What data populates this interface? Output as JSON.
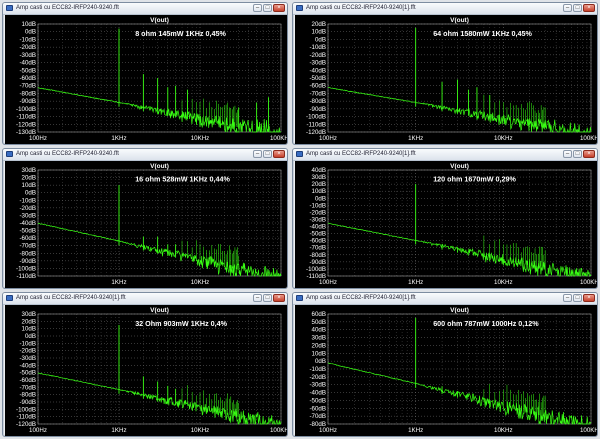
{
  "colors": {
    "trace": "#39ff14",
    "plot_bg": "#000000",
    "grid": "#6e6e6e",
    "label": "#ffffff"
  },
  "windows": [
    {
      "title": "Amp casti cu ECC82-IRFP240-9240.fft",
      "chart_data": {
        "type": "line",
        "trace_name": "V(out)",
        "annotation": "8 ohm  145mW 1KHz 0,45%",
        "yticks": [
          "10dB",
          "0dB",
          "-10dB",
          "-20dB",
          "-30dB",
          "-40dB",
          "-50dB",
          "-60dB",
          "-70dB",
          "-80dB",
          "-90dB",
          "-100dB",
          "-110dB",
          "-120dB",
          "-130dB"
        ],
        "ylim": [
          -130,
          10
        ],
        "xticks": [
          "100Hz",
          "1KHz",
          "10KHz",
          "100KHz"
        ],
        "xlim": [
          100,
          100000
        ],
        "x_scale": "log",
        "grid": true,
        "series": [
          {
            "x": [
              100,
              1000,
              2000,
              3000,
              4000,
              5000,
              7000,
              30000,
              50000,
              70000,
              100000
            ],
            "y": [
              -72,
              4,
              -55,
              -60,
              -72,
              -70,
              -75,
              -98,
              -92,
              -85,
              -130
            ]
          }
        ]
      }
    },
    {
      "title": "Amp casti cu ECC82-IRFP240-9240[1].fft",
      "chart_data": {
        "type": "line",
        "trace_name": "V(out)",
        "annotation": "64 ohm 1580mW 1KHz 0,45%",
        "yticks": [
          "20dB",
          "10dB",
          "0dB",
          "-10dB",
          "-20dB",
          "-30dB",
          "-40dB",
          "-50dB",
          "-60dB",
          "-70dB",
          "-80dB",
          "-90dB",
          "-100dB",
          "-110dB",
          "-120dB"
        ],
        "ylim": [
          -120,
          20
        ],
        "xticks": [
          "100Hz",
          "1KHz",
          "10KHz",
          "100KHz"
        ],
        "xlim": [
          100,
          100000
        ],
        "x_scale": "log",
        "grid": true,
        "series": [
          {
            "x": [
              100,
              1000,
              2000,
              3000,
              4000,
              5000,
              7000,
              100000
            ],
            "y": [
              -62,
              15,
              -55,
              -52,
              -65,
              -62,
              -72,
              -120
            ]
          }
        ]
      }
    },
    {
      "title": "Amp casti cu ECC82-IRFP240-9240.fft",
      "chart_data": {
        "type": "line",
        "trace_name": "V(out)",
        "annotation": "16 ohm 528mW 1KHz 0,44%",
        "yticks": [
          "30dB",
          "20dB",
          "10dB",
          "0dB",
          "-10dB",
          "-20dB",
          "-30dB",
          "-40dB",
          "-50dB",
          "-60dB",
          "-70dB",
          "-80dB",
          "-90dB",
          "-100dB",
          "-110dB"
        ],
        "ylim": [
          -110,
          30
        ],
        "xticks": [
          "1KHz",
          "10KHz"
        ],
        "xlim": [
          100,
          100000
        ],
        "x_scale": "log",
        "grid": true,
        "series": [
          {
            "x": [
              100,
              1000,
              2000,
              3000,
              4000,
              5000,
              100000
            ],
            "y": [
              -40,
              10,
              -58,
              -58,
              -68,
              -68,
              -110
            ]
          }
        ]
      }
    },
    {
      "title": "Amp casti cu ECC82-IRFP240-9240[1].fft",
      "chart_data": {
        "type": "line",
        "trace_name": "V(out)",
        "annotation": "120 ohm 1670mW 0,29%",
        "yticks": [
          "40dB",
          "30dB",
          "20dB",
          "10dB",
          "0dB",
          "-10dB",
          "-20dB",
          "-30dB",
          "-40dB",
          "-50dB",
          "-60dB",
          "-70dB",
          "-80dB",
          "-90dB",
          "-100dB",
          "-110dB"
        ],
        "ylim": [
          -110,
          40
        ],
        "xticks": [
          "100Hz",
          "1KHz",
          "10KHz",
          "100KHz"
        ],
        "xlim": [
          100,
          100000
        ],
        "x_scale": "log",
        "grid": true,
        "series": [
          {
            "x": [
              100,
              1000,
              2000,
              3000,
              100000
            ],
            "y": [
              -35,
              20,
              -65,
              -70,
              -108
            ]
          }
        ]
      }
    },
    {
      "title": "Amp casti cu ECC82-IRFP240-9240[1].fft",
      "chart_data": {
        "type": "line",
        "trace_name": "V(out)",
        "annotation": "32 Ohm 903mW 1KHz 0,4%",
        "yticks": [
          "30dB",
          "20dB",
          "10dB",
          "0dB",
          "-10dB",
          "-20dB",
          "-30dB",
          "-40dB",
          "-50dB",
          "-60dB",
          "-70dB",
          "-80dB",
          "-90dB",
          "-100dB",
          "-110dB",
          "-120dB"
        ],
        "ylim": [
          -120,
          30
        ],
        "xticks": [
          "100Hz",
          "1KHz",
          "10KHz",
          "100KHz"
        ],
        "xlim": [
          100,
          100000
        ],
        "x_scale": "log",
        "grid": true,
        "series": [
          {
            "x": [
              100,
              1000,
              2000,
              3000,
              4000,
              5000,
              100000
            ],
            "y": [
              -50,
              15,
              -55,
              -62,
              -68,
              -72,
              -118
            ]
          }
        ]
      }
    },
    {
      "title": "Amp casti cu ECC82-IRFP240-9240[1].fft",
      "chart_data": {
        "type": "line",
        "trace_name": "V(out)",
        "annotation": "600 ohm 787mW 1000Hz 0,12%",
        "yticks": [
          "60dB",
          "50dB",
          "40dB",
          "30dB",
          "20dB",
          "10dB",
          "0dB",
          "-10dB",
          "-20dB",
          "-30dB",
          "-40dB",
          "-50dB",
          "-60dB",
          "-70dB",
          "-80dB"
        ],
        "ylim": [
          -80,
          60
        ],
        "xticks": [
          "100Hz",
          "1KHz",
          "10KHz",
          "100KHz"
        ],
        "xlim": [
          100,
          100000
        ],
        "x_scale": "log",
        "grid": true,
        "series": [
          {
            "x": [
              100,
              1000,
              2000,
              3000,
              100000
            ],
            "y": [
              -2,
              55,
              -32,
              -38,
              -80
            ]
          }
        ]
      }
    }
  ]
}
